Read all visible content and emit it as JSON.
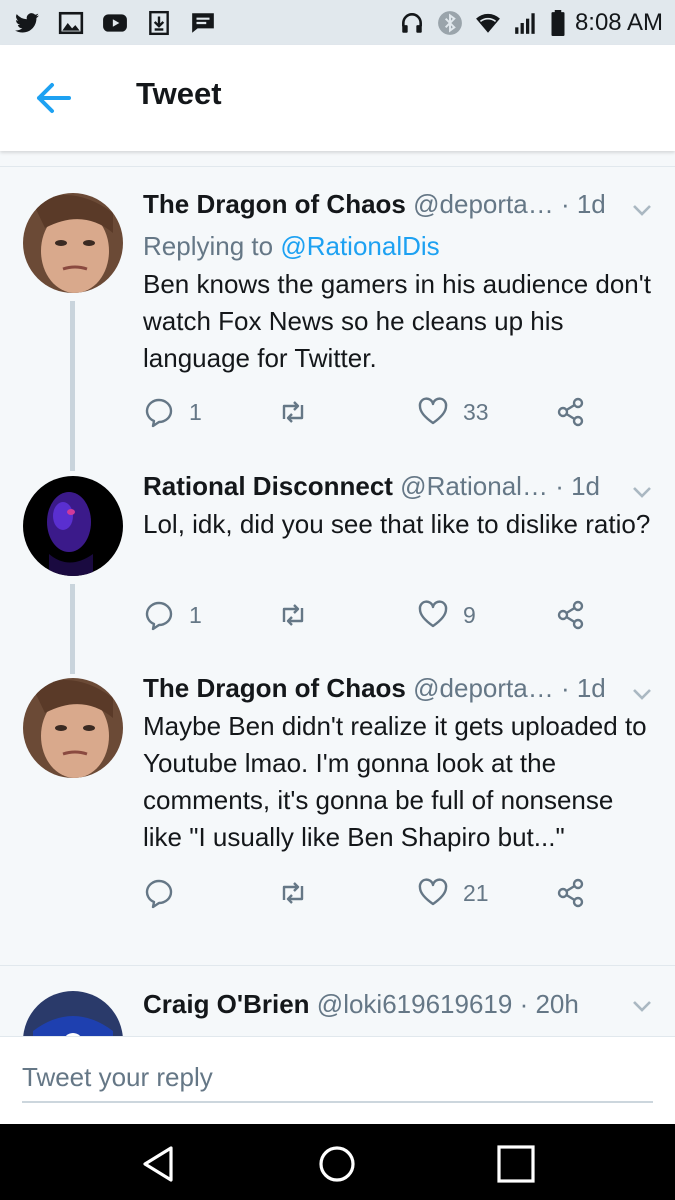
{
  "status_bar": {
    "time": "8:08 AM",
    "icons": [
      "twitter-icon",
      "gallery-icon",
      "youtube-icon",
      "download-icon",
      "message-icon",
      "headphones-icon",
      "bluetooth-icon",
      "wifi-icon",
      "signal-icon",
      "battery-icon"
    ]
  },
  "header": {
    "title": "Tweet",
    "back_icon": "arrow-left-icon"
  },
  "tweets": [
    {
      "name": "The Dragon of Chaos",
      "handle": "@deporta…",
      "time": "· 1d",
      "replying_prefix": "Replying to ",
      "replying_to": "@RationalDis",
      "text": "Ben knows the gamers in his audience don't watch Fox News so he cleans up his language for Twitter.",
      "replies": "1",
      "retweets": "",
      "likes": "33"
    },
    {
      "name": "Rational Disconnect",
      "handle": "@Rational…",
      "time": "· 1d",
      "text": "Lol, idk, did you see that like to dislike ratio?",
      "replies": "1",
      "retweets": "",
      "likes": "9"
    },
    {
      "name": "The Dragon of Chaos",
      "handle": "@deporta…",
      "time": "· 1d",
      "text": "Maybe Ben didn't realize it gets uploaded to Youtube lmao. I'm gonna look at the comments, it's gonna be full of nonsense like \"I usually like Ben Shapiro but...\"",
      "replies": "",
      "retweets": "",
      "likes": "21"
    },
    {
      "name": "Craig O'Brien",
      "handle": "@loki619619619",
      "time": "· 20h"
    }
  ],
  "reply_bar": {
    "placeholder": "Tweet your reply"
  },
  "nav": {
    "icons": [
      "back-triangle-icon",
      "home-circle-icon",
      "recents-square-icon"
    ]
  },
  "colors": {
    "accent": "#1da1f2",
    "secondary_text": "#657786",
    "background": "#f5f8fa"
  }
}
